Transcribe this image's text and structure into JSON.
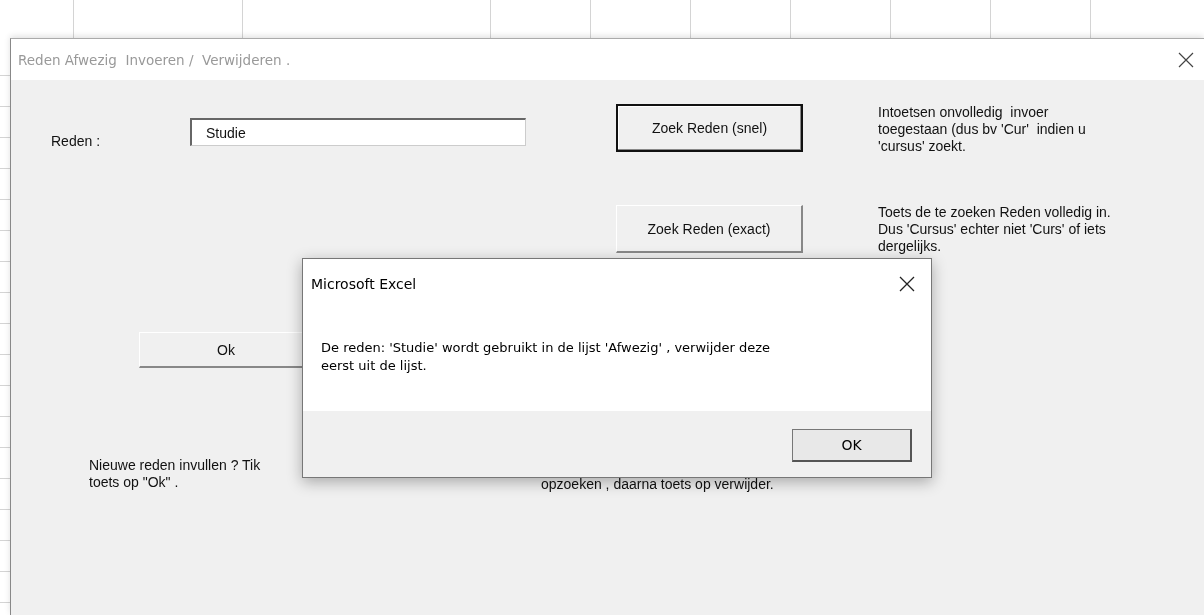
{
  "form": {
    "title": "Reden Afwezig  Invoeren /  Verwijderen .",
    "reason_label": "Reden :",
    "reason_field": {
      "value": "Studie"
    },
    "buttons": [
      {
        "label": "Zoek Reden (snel)",
        "default": true,
        "kind": "snel"
      },
      {
        "label": "Zoek Reden (exact)",
        "default": false,
        "kind": "exact"
      },
      {
        "label": "Ok",
        "default": false,
        "kind": "ok"
      }
    ],
    "hints": [
      {
        "text": "Intoetsen onvolledig  invoer\ntoegestaan (dus bv 'Cur'  indien u\n'cursus' zoekt.",
        "kind": "snel"
      },
      {
        "text": "Toets de te zoeken Reden volledig in.\nDus 'Cursus' echter niet 'Curs' of iets\ndergelijks.",
        "kind": "exact"
      },
      {
        "text": "Nieuwe reden invullen ? Tik\ntoets op \"Ok\" .",
        "kind": "new"
      },
      {
        "text": "opzoeken , daarna toets op verwijder.",
        "kind": "delete"
      }
    ]
  },
  "message_box": {
    "title": "Microsoft Excel",
    "message": "De reden: 'Studie' wordt gebruikt in de lijst 'Afwezig' , verwijder deze eerst uit de lijst.",
    "button": "OK"
  }
}
